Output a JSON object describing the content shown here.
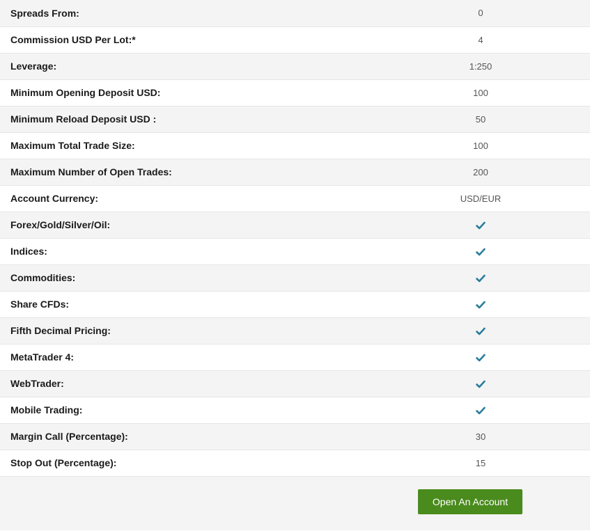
{
  "rows": [
    {
      "label": "Spreads From:",
      "value": "0"
    },
    {
      "label": "Commission USD Per Lot:*",
      "value": "4"
    },
    {
      "label": "Leverage:",
      "value": "1:250"
    },
    {
      "label": "Minimum Opening Deposit USD:",
      "value": "100"
    },
    {
      "label": "Minimum Reload Deposit USD :",
      "value": "50"
    },
    {
      "label": "Maximum Total Trade Size:",
      "value": "100"
    },
    {
      "label": "Maximum Number of Open Trades:",
      "value": "200"
    },
    {
      "label": "Account Currency:",
      "value": "USD/EUR"
    },
    {
      "label": "Forex/Gold/Silver/Oil:",
      "icon": "check-icon"
    },
    {
      "label": "Indices:",
      "icon": "check-icon"
    },
    {
      "label": "Commodities:",
      "icon": "check-icon"
    },
    {
      "label": "Share CFDs:",
      "icon": "check-icon"
    },
    {
      "label": "Fifth Decimal Pricing:",
      "icon": "check-icon"
    },
    {
      "label": "MetaTrader 4:",
      "icon": "check-icon"
    },
    {
      "label": "WebTrader:",
      "icon": "check-icon"
    },
    {
      "label": "Mobile Trading:",
      "icon": "check-icon"
    },
    {
      "label": "Margin Call (Percentage):",
      "value": "30"
    },
    {
      "label": "Stop Out (Percentage):",
      "value": "15"
    }
  ],
  "footer": {
    "button_label": "Open An Account"
  },
  "colors": {
    "check": "#2a7d9c",
    "button": "#4a8b1d",
    "row_alt": "#f4f4f4"
  }
}
